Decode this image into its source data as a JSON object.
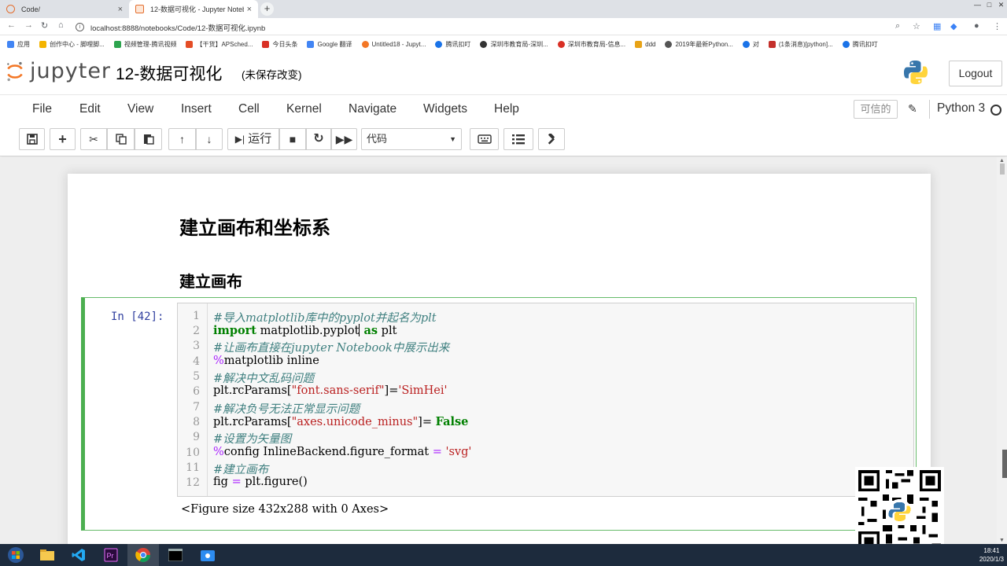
{
  "browser": {
    "tabs": [
      {
        "label": "Code/",
        "close": "×"
      },
      {
        "label": "12-数据可视化 - Jupyter Notebo",
        "close": "×"
      }
    ],
    "new_tab": "+",
    "window_buttons": [
      "—",
      "□",
      "✕"
    ],
    "url": "localhost:8888/notebooks/Code/12-数据可视化.ipynb",
    "bookmarks": [
      "应用",
      "创作中心 - 脚哩脚...",
      "视频管理-腾讯视频",
      "【干货】APSched...",
      "今日头条",
      "Google 翻译",
      "Untitled18 - Jupyt...",
      "腾讯扣叮",
      "深圳市教育局-深圳...",
      "深圳市教育局-信息...",
      "ddd",
      "2019年最新Python...",
      "对",
      "(1条消息)[python]...",
      "腾讯扣叮"
    ],
    "bookmark_colors": [
      "#4285f4",
      "#f4b400",
      "#2da44e",
      "#e44d26",
      "#d93025",
      "#4285f4",
      "#f37726",
      "#1a73e8",
      "#333333",
      "#d93025",
      "#e8a317",
      "#555555",
      "#1a73e8",
      "#c4302b",
      "#1a73e8"
    ]
  },
  "jupyter": {
    "logo_text": "jupyter",
    "notebook_title": "12-数据可视化",
    "unsaved": "(未保存改变)",
    "logout": "Logout",
    "menus": [
      "File",
      "Edit",
      "View",
      "Insert",
      "Cell",
      "Kernel",
      "Navigate",
      "Widgets",
      "Help"
    ],
    "trusted": "可信的",
    "kernel_name": "Python 3",
    "run_label": "运行",
    "cell_type": "代码"
  },
  "notebook": {
    "heading1": "建立画布和坐标系",
    "heading2": "建立画布",
    "prompt": "In  [42]:",
    "line_numbers": [
      "1",
      "2",
      "3",
      "4",
      "5",
      "6",
      "7",
      "8",
      "9",
      "10",
      "11",
      "12"
    ],
    "code": {
      "l1": "#导入matplotlib库中的pyplot并起名为plt",
      "l2_a": "import",
      "l2_b": " matplotlib.pyplot",
      "l2_c": " as",
      "l2_d": " plt",
      "l3": "#让画布直接在jupyter Notebook中展示出来",
      "l4_a": "%",
      "l4_b": "matplotlib inline",
      "l5": "#解决中文乱码问题",
      "l6_a": "plt.rcParams[",
      "l6_b": "\"font.sans-serif\"",
      "l6_c": "]=",
      "l6_d": "'SimHei'",
      "l7": "#解决负号无法正常显示问题",
      "l8_a": "plt.rcParams[",
      "l8_b": "\"axes.unicode_minus\"",
      "l8_c": "]= ",
      "l8_d": "False",
      "l9": "#设置为矢量图",
      "l10_a": "%",
      "l10_b": "config InlineBackend.figure_format ",
      "l10_c": "=",
      "l10_d": " 'svg'",
      "l11": "#建立画布",
      "l12_a": "fig ",
      "l12_b": "=",
      "l12_c": " plt.figure()"
    },
    "output": "<Figure size 432x288 with 0 Axes>"
  },
  "taskbar": {
    "time": "18:41",
    "date": "2020/1/3"
  }
}
